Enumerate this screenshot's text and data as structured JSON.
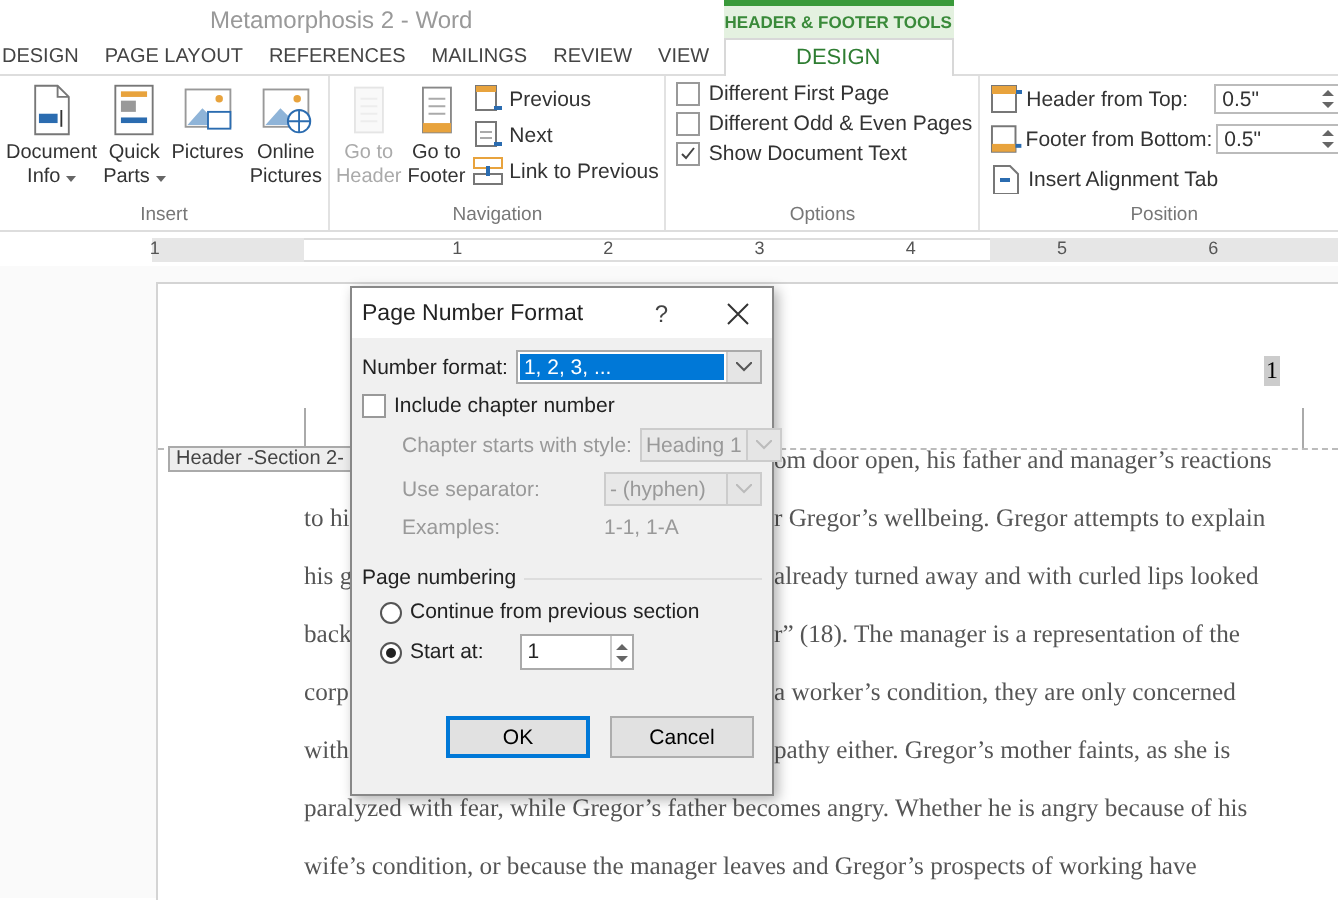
{
  "window": {
    "title": "Metamorphosis 2 - Word"
  },
  "tabs": [
    {
      "label": "DESIGN",
      "selected": false
    },
    {
      "label": "PAGE LAYOUT",
      "selected": false
    },
    {
      "label": "REFERENCES",
      "selected": false
    },
    {
      "label": "MAILINGS",
      "selected": false
    },
    {
      "label": "REVIEW",
      "selected": false
    },
    {
      "label": "VIEW",
      "selected": false
    }
  ],
  "contextual_tabs": {
    "group_label": "HEADER & FOOTER TOOLS",
    "tabs": [
      {
        "label": "DESIGN",
        "selected": true
      }
    ]
  },
  "ribbon": {
    "groups": [
      {
        "label": "Insert",
        "items": [
          {
            "kind": "large",
            "lines": [
              "Document",
              "Info"
            ],
            "dropdown": true,
            "disabled": false
          },
          {
            "kind": "large",
            "lines": [
              "Quick",
              "Parts"
            ],
            "dropdown": true,
            "disabled": false
          },
          {
            "kind": "large",
            "lines": [
              "Pictures"
            ],
            "dropdown": false,
            "disabled": false
          },
          {
            "kind": "large",
            "lines": [
              "Online",
              "Pictures"
            ],
            "dropdown": false,
            "disabled": false
          }
        ]
      },
      {
        "label": "Navigation",
        "items": [
          {
            "kind": "large",
            "lines": [
              "Go to",
              "Header"
            ],
            "dropdown": false,
            "disabled": true
          },
          {
            "kind": "large",
            "lines": [
              "Go to",
              "Footer"
            ],
            "dropdown": false,
            "disabled": false
          },
          {
            "kind": "stack",
            "items": [
              {
                "label": "Previous"
              },
              {
                "label": "Next"
              },
              {
                "label": "Link to Previous"
              }
            ]
          }
        ]
      },
      {
        "label": "Options",
        "items": [
          {
            "kind": "checks",
            "items": [
              {
                "label": "Different First Page",
                "checked": false
              },
              {
                "label": "Different Odd & Even Pages",
                "checked": false
              },
              {
                "label": "Show Document Text",
                "checked": true
              }
            ]
          }
        ]
      },
      {
        "label": "Position",
        "items": [
          {
            "kind": "position",
            "spins": [
              {
                "label": "Header from Top:",
                "value": "0.5\""
              },
              {
                "label": "Footer from Bottom:",
                "value": "0.5\""
              }
            ],
            "button": {
              "label": "Insert Alignment Tab"
            }
          }
        ]
      }
    ]
  },
  "ruler": {
    "labels": [
      "1",
      "1",
      "2",
      "3",
      "4",
      "5",
      "6"
    ]
  },
  "document": {
    "header_tag": "Header -Section 2-",
    "page_number": "1",
    "lines": [
      {
        "right": "om door open, his father and manager’s reactions"
      },
      {
        "left": "to hi",
        "right": "r Gregor’s wellbeing. Gregor attempts to explain"
      },
      {
        "left": "his g",
        "right": " already turned away and with curled lips looked"
      },
      {
        "left": "back",
        "right": "r” (18). The manager is a representation of the"
      },
      {
        "left": "corp",
        "right": " a worker’s condition, they are only concerned"
      },
      {
        "left": "with",
        "right": "pathy either. Gregor’s mother faints, as she is"
      },
      {
        "full": "paralyzed with fear, while Gregor’s father becomes angry. Whether he is angry because of his"
      },
      {
        "full": "wife’s condition, or because the manager leaves and Gregor’s prospects of working have"
      }
    ]
  },
  "dialog": {
    "title": "Page Number Format",
    "help": "?",
    "number_format": {
      "label": "Number format:",
      "value": "1, 2, 3, ..."
    },
    "include_chapter": {
      "label": "Include chapter number",
      "checked": false
    },
    "chapter_style": {
      "label": "Chapter starts with style:",
      "value": "Heading 1",
      "disabled": true
    },
    "separator": {
      "label": "Use separator:",
      "value": "-   (hyphen)",
      "disabled": true
    },
    "examples": {
      "label": "Examples:",
      "value": "1-1, 1-A"
    },
    "page_numbering": {
      "label": "Page numbering",
      "options": [
        {
          "label": "Continue from previous section",
          "selected": false
        },
        {
          "label": "Start at:",
          "selected": true,
          "value": "1"
        }
      ]
    },
    "buttons": [
      {
        "label": "OK",
        "default": true
      },
      {
        "label": "Cancel",
        "default": false
      }
    ]
  }
}
